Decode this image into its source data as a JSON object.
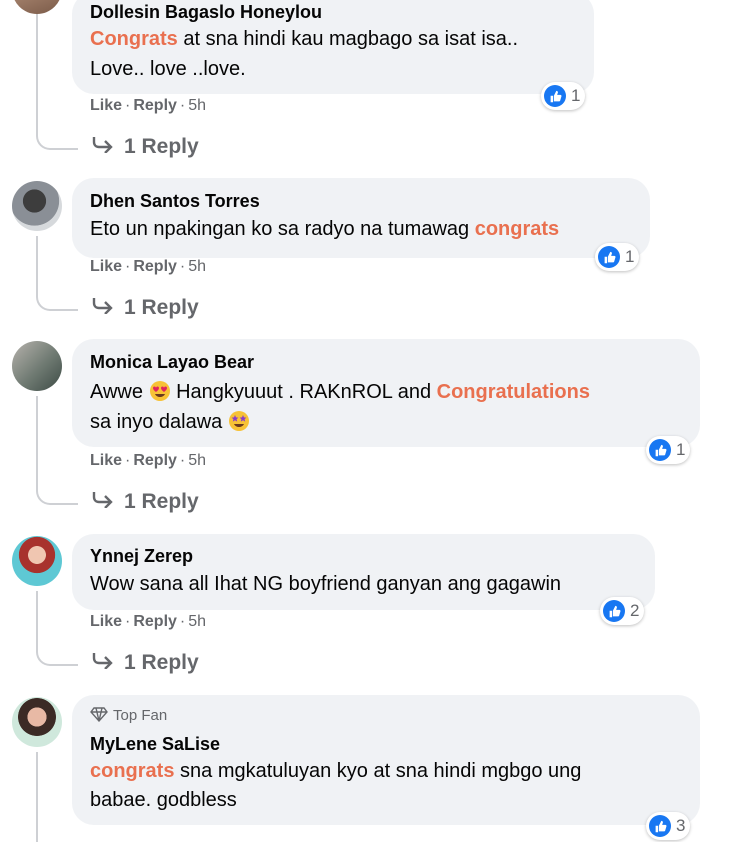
{
  "colors": {
    "highlight": "#e9704f",
    "bubble": "#f0f2f5",
    "meta": "#65676b",
    "like_blue": "#1877f2"
  },
  "labels": {
    "like": "Like",
    "reply": "Reply",
    "separator": "·"
  },
  "comments": [
    {
      "author": "Dollesin Bagaslo Honeylou",
      "text_hl": "Congrats",
      "text_line1": " at sna hindi kau magbago sa isat isa..",
      "text_line2": "Love.. love ..love.",
      "time": "5h",
      "reactions": "1",
      "reply_count": "1 Reply"
    },
    {
      "author": "Dhen Santos Torres",
      "text_line1": "Eto un npakingan ko sa radyo na tumawag ",
      "text_hl": "congrats",
      "time": "5h",
      "reactions": "1",
      "reply_count": "1 Reply"
    },
    {
      "author": "Monica Layao Bear",
      "text_a": "Awwe ",
      "text_b": " Hangkyuuut . RAKnROL and ",
      "text_hl": "Congratulations",
      "text_line2": "sa inyo dalawa ",
      "time": "5h",
      "reactions": "1",
      "reply_count": "1 Reply"
    },
    {
      "author": "Ynnej Zerep",
      "text_line1": "Wow sana all Ihat NG boyfriend ganyan ang gagawin",
      "time": "5h",
      "reactions": "2",
      "reply_count": "1 Reply"
    },
    {
      "badge": "Top Fan",
      "author": "MyLene SaLise",
      "text_hl": "congrats",
      "text_line1": " sna mgkatuluyan kyo at sna hindi mgbgo ung",
      "text_line2": "babae. godbless",
      "reactions": "3"
    }
  ]
}
